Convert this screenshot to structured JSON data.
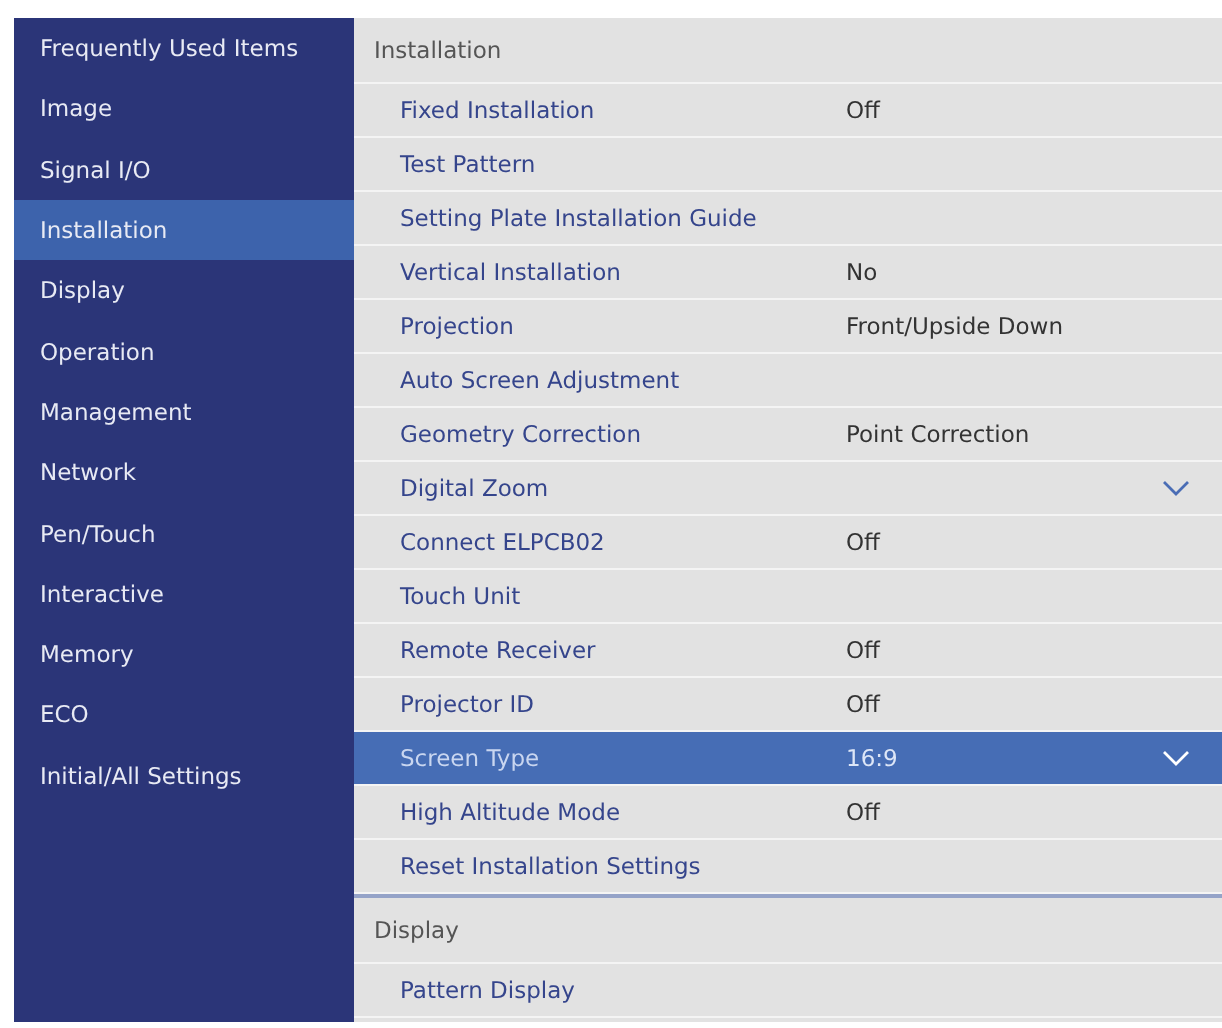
{
  "sidebar": {
    "items": [
      {
        "label": "Frequently Used Items",
        "selected": false
      },
      {
        "label": "Image",
        "selected": false
      },
      {
        "label": "Signal I/O",
        "selected": false
      },
      {
        "label": "Installation",
        "selected": true
      },
      {
        "label": "Display",
        "selected": false
      },
      {
        "label": "Operation",
        "selected": false
      },
      {
        "label": "Management",
        "selected": false
      },
      {
        "label": "Network",
        "selected": false
      },
      {
        "label": "Pen/Touch",
        "selected": false
      },
      {
        "label": "Interactive",
        "selected": false
      },
      {
        "label": "Memory",
        "selected": false
      },
      {
        "label": "ECO",
        "selected": false
      },
      {
        "label": "Initial/All Settings",
        "selected": false
      }
    ]
  },
  "sections": [
    {
      "title": "Installation",
      "rows": [
        {
          "label": "Fixed Installation",
          "value": "Off",
          "kind": "setting",
          "selected": false
        },
        {
          "label": "Test Pattern",
          "kind": "setting",
          "selected": false
        },
        {
          "label": "Setting Plate Installation Guide",
          "kind": "setting",
          "selected": false
        },
        {
          "label": "Vertical Installation",
          "value": "No",
          "kind": "setting",
          "selected": false
        },
        {
          "label": "Projection",
          "value": "Front/Upside Down",
          "kind": "setting",
          "selected": false
        },
        {
          "label": "Auto Screen Adjustment",
          "kind": "setting",
          "selected": false
        },
        {
          "label": "Geometry Correction",
          "value": "Point Correction",
          "kind": "setting",
          "selected": false
        },
        {
          "label": "Digital Zoom",
          "kind": "dropdown",
          "selected": false
        },
        {
          "label": "Connect ELPCB02",
          "value": "Off",
          "kind": "setting",
          "selected": false
        },
        {
          "label": "Touch Unit",
          "kind": "setting",
          "selected": false
        },
        {
          "label": "Remote Receiver",
          "value": "Off",
          "kind": "setting",
          "selected": false
        },
        {
          "label": "Projector ID",
          "value": "Off",
          "kind": "setting",
          "selected": false
        },
        {
          "label": "Screen Type",
          "value": "16:9",
          "kind": "dropdown",
          "selected": true
        },
        {
          "label": "High Altitude Mode",
          "value": "Off",
          "kind": "setting",
          "selected": false
        },
        {
          "label": "Reset Installation Settings",
          "kind": "setting",
          "selected": false
        }
      ]
    },
    {
      "title": "Display",
      "rows": [
        {
          "label": "Pattern Display",
          "kind": "setting",
          "selected": false
        }
      ]
    }
  ]
}
